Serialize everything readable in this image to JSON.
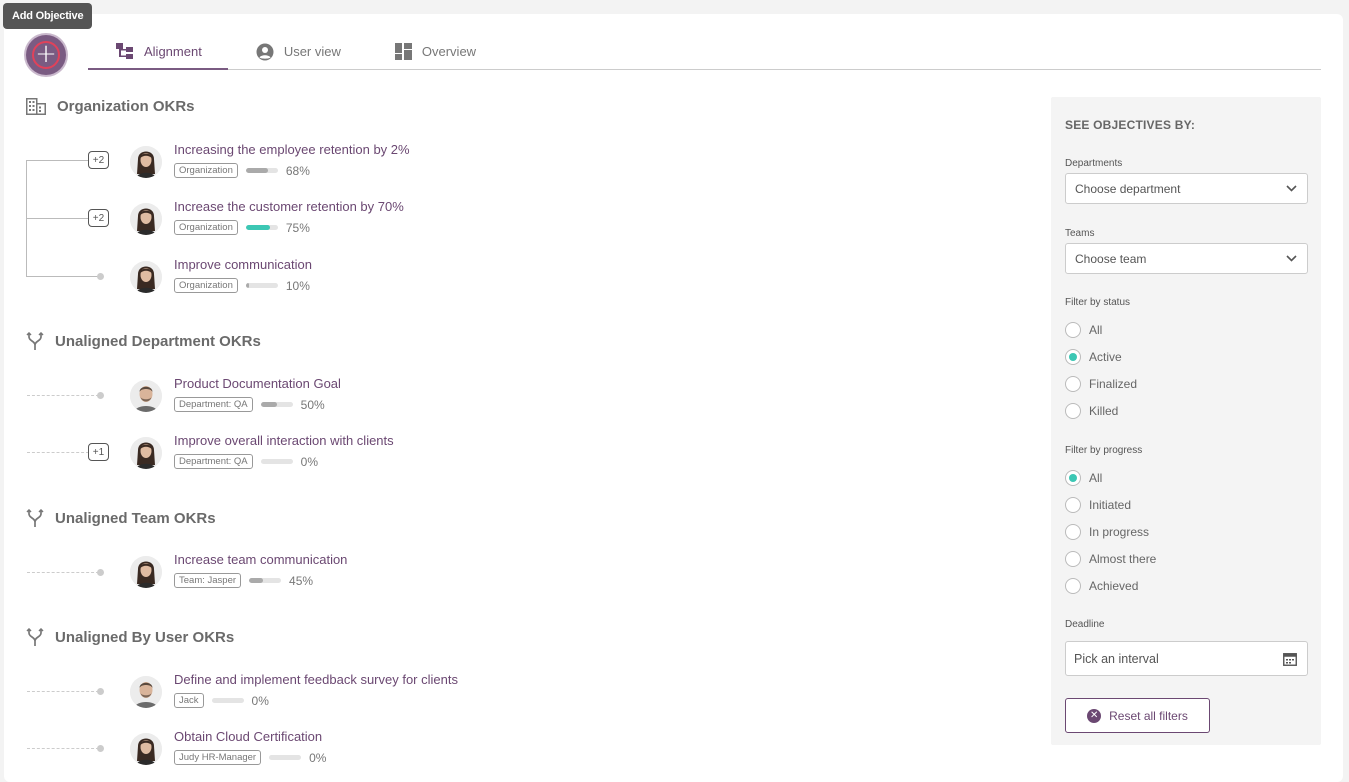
{
  "tooltip": "Add Objective",
  "tabs": [
    {
      "label": "Alignment",
      "active": true,
      "icon": "hierarchy-icon"
    },
    {
      "label": "User view",
      "active": false,
      "icon": "user-circle-icon"
    },
    {
      "label": "Overview",
      "active": false,
      "icon": "dashboard-icon"
    }
  ],
  "sections": {
    "org": {
      "title": "Organization OKRs",
      "icon": "building-icon"
    },
    "dept": {
      "title": "Unaligned Department OKRs",
      "icon": "fork-icon"
    },
    "team": {
      "title": "Unaligned Team OKRs",
      "icon": "fork-icon"
    },
    "user": {
      "title": "Unaligned By User OKRs",
      "icon": "fork-icon"
    }
  },
  "objectives": [
    {
      "title": "Increasing the employee retention by 2%",
      "tag": "Organization",
      "progress": "68%",
      "progress_value": 0.68,
      "children": "+2",
      "avatar": "female"
    },
    {
      "title": "Increase the customer retention by 70%",
      "tag": "Organization",
      "progress": "75%",
      "progress_value": 0.75,
      "children": "+2",
      "avatar": "female",
      "bar_color": "#3cc7b4"
    },
    {
      "title": "Improve communication",
      "tag": "Organization",
      "progress": "10%",
      "progress_value": 0.1,
      "avatar": "female"
    },
    {
      "title": "Product Documentation Goal",
      "tag": "Department: QA",
      "progress": "50%",
      "progress_value": 0.5,
      "avatar": "male"
    },
    {
      "title": "Improve overall interaction with clients",
      "tag": "Department: QA",
      "progress": "0%",
      "progress_value": 0,
      "children": "+1",
      "avatar": "female"
    },
    {
      "title": "Increase team communication",
      "tag": "Team: Jasper",
      "progress": "45%",
      "progress_value": 0.45,
      "avatar": "female"
    },
    {
      "title": "Define and implement feedback survey for clients",
      "tag": "Jack",
      "progress": "0%",
      "progress_value": 0,
      "avatar": "male"
    },
    {
      "title": "Obtain Cloud Certification",
      "tag": "Judy HR-Manager",
      "progress": "0%",
      "progress_value": 0,
      "avatar": "female"
    }
  ],
  "filters": {
    "header": "SEE OBJECTIVES BY:",
    "departments_label": "Departments",
    "departments_value": "Choose department",
    "teams_label": "Teams",
    "teams_value": "Choose team",
    "status_label": "Filter by status",
    "status_options": [
      {
        "label": "All",
        "selected": false
      },
      {
        "label": "Active",
        "selected": true
      },
      {
        "label": "Finalized",
        "selected": false
      },
      {
        "label": "Killed",
        "selected": false
      }
    ],
    "progress_label": "Filter by progress",
    "progress_options": [
      {
        "label": "All",
        "selected": true
      },
      {
        "label": "Initiated",
        "selected": false
      },
      {
        "label": "In progress",
        "selected": false
      },
      {
        "label": "Almost there",
        "selected": false
      },
      {
        "label": "Achieved",
        "selected": false
      }
    ],
    "deadline_label": "Deadline",
    "deadline_value": "Pick an interval",
    "reset_label": "Reset all filters"
  },
  "colors": {
    "accent": "#6b4872",
    "success": "#3cc7b4",
    "bar": "#aaaaaa"
  }
}
